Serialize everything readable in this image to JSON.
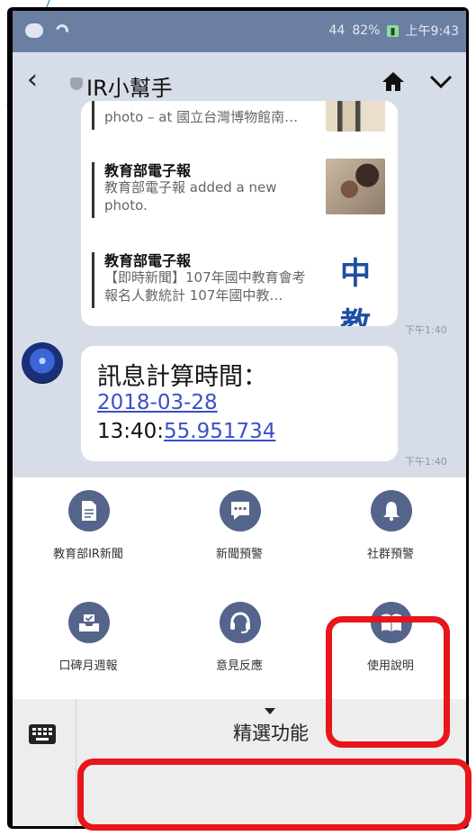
{
  "status_bar": {
    "signal_text": "44",
    "battery_text": "82%",
    "battery_badge": "",
    "clock": "上午9:43"
  },
  "header": {
    "title": "IR小幫手"
  },
  "feed": {
    "items": [
      {
        "title": "",
        "desc": "photo – at 國立台灣博物館南…"
      },
      {
        "title": "教育部電子報",
        "desc": "教育部電子報 added a new photo."
      },
      {
        "title": "教育部電子報",
        "desc": "【即時新聞】107年國中教育會考報名人數統計 107年國中教…",
        "thumb_text": "中教"
      }
    ],
    "time": "下午1:40"
  },
  "message": {
    "line1": "訊息計算時間：",
    "date_link": "2018-03-28",
    "time_prefix": "13:40:",
    "time_link": "55.951734",
    "time": "下午1:40"
  },
  "rich_menu": {
    "items": [
      {
        "label": "教育部IR新聞",
        "icon": "document-icon"
      },
      {
        "label": "新聞預警",
        "icon": "chat-bubble-icon"
      },
      {
        "label": "社群預警",
        "icon": "bell-icon"
      },
      {
        "label": "口碑月週報",
        "icon": "inbox-check-icon"
      },
      {
        "label": "意見反應",
        "icon": "headset-icon"
      },
      {
        "label": "使用說明",
        "icon": "book-icon"
      }
    ]
  },
  "bottom_bar": {
    "menu_label": "精選功能"
  },
  "colors": {
    "status_bar": "#6b7fa3",
    "chat_bg": "#d7dde8",
    "icon_circle": "#55648a",
    "link": "#3b4fc7",
    "highlight": "#e8151b"
  }
}
